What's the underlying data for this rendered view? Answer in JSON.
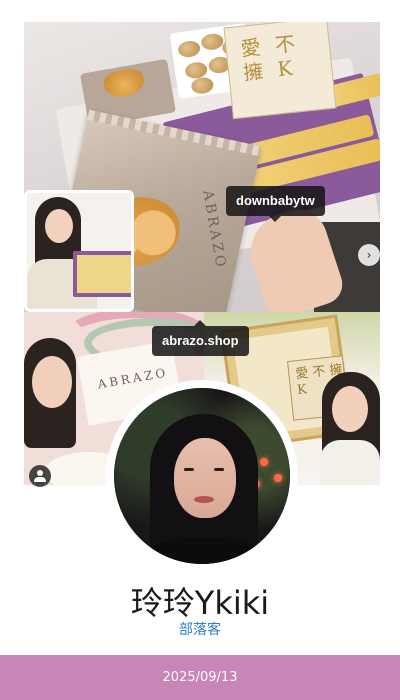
{
  "post": {
    "tags": [
      {
        "handle": "downbabytw"
      },
      {
        "handle": "abrazo.shop"
      }
    ],
    "photo_text": {
      "brand_card_chars": "愛 不 擁 K",
      "pouch_brand": "ABRAZO",
      "card_brand": "ABRAZO",
      "gift_card_chars": "愛 不 擁 K"
    },
    "controls": {
      "next_symbol": "›",
      "next_icon": "chevron-right-icon",
      "tagged_users_icon": "user-icon"
    }
  },
  "profile": {
    "name": "玲玲Ykiki",
    "category": "部落客"
  },
  "footer": {
    "date": "2025/09/13",
    "color": "#c885b7"
  }
}
